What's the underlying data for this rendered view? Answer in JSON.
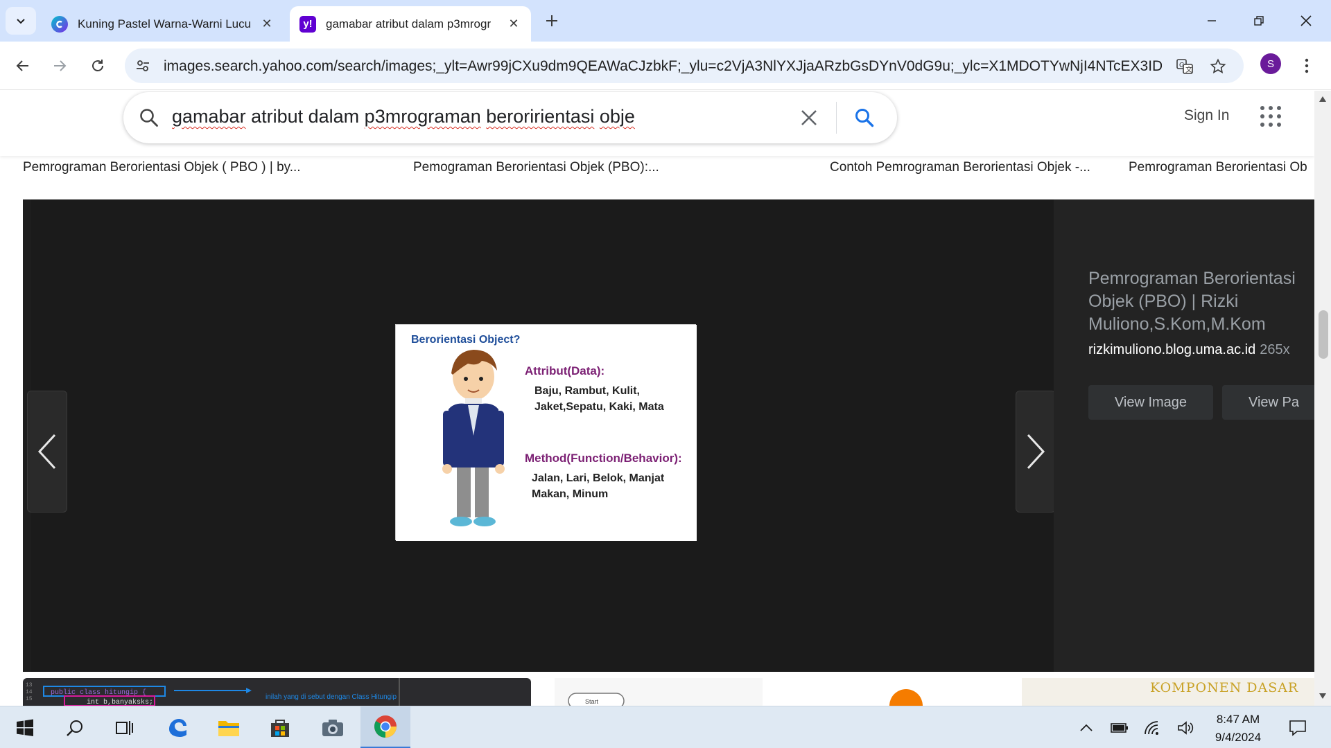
{
  "browser": {
    "tabs": [
      {
        "title": "Kuning Pastel Warna-Warni Lucu",
        "active": false,
        "favicon": "canva-icon"
      },
      {
        "title": "gamabar atribut dalam p3mrogr",
        "active": true,
        "favicon": "yahoo-icon"
      }
    ],
    "url": "images.search.yahoo.com/search/images;_ylt=Awr99jCXu9dm9QEAWaCJzbkF;_ylu=c2VjA3NlYXJjaARzbGsDYnV0dG9u;_ylc=X1MDOTYwNjI4NTcEX3IDMgR...",
    "profile_initial": "S"
  },
  "yahoo": {
    "query_parts": [
      "gamabar",
      " atribut dalam ",
      "p3mrograman",
      " ",
      "beroririentasi",
      " ",
      "obje"
    ],
    "sign_in": "Sign In"
  },
  "captions": [
    "Pemrograman Berorientasi Objek ( PBO ) | by...",
    "Pemograman Berorientasi Objek (PBO):...",
    "Contoh Pemrograman Berorientasi Objek -...",
    "Pemrograman Berorientasi Ob"
  ],
  "viewer": {
    "image": {
      "heading": "Berorientasi Object?",
      "attr_title": "Attribut(Data):",
      "attr_line1": "Baju, Rambut, Kulit,",
      "attr_line2": "Jaket,Sepatu, Kaki, Mata",
      "method_title": "Method(Function/Behavior):",
      "method_line1": "Jalan, Lari, Belok, Manjat",
      "method_line2": "Makan, Minum"
    },
    "side_title": "Pemrograman Berorientasi Objek (PBO) | Rizki Muliono,S.Kom,M.Kom",
    "domain": "rizkimuliono.blog.uma.ac.id",
    "dimensions": "265x",
    "view_image": "View Image",
    "view_page": "View Pa"
  },
  "strip": {
    "code_caption": "inilah yang di sebut dengan Class Hitungip",
    "code_line1": "public class hitungip {",
    "code_line2": "int b,banyaksks;",
    "komponen": "KOMPONEN DASAR",
    "start": "Start"
  },
  "taskbar": {
    "time": "8:47 AM",
    "date": "9/4/2024"
  },
  "colors": {
    "tabstrip": "#d3e3fd",
    "yahoo_purple": "#6001d2",
    "search_blue": "#1a73e8",
    "viewer_bg": "#1e1e1e"
  }
}
